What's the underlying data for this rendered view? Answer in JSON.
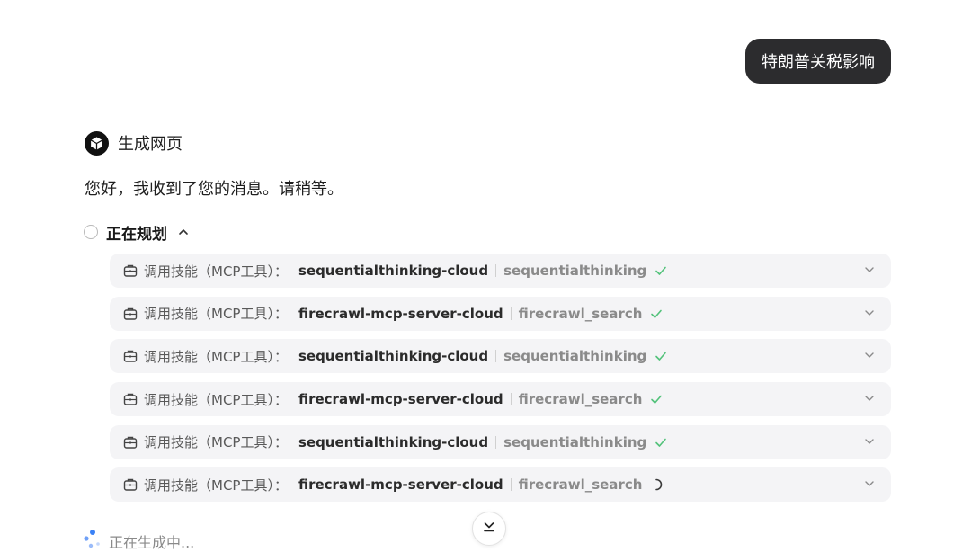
{
  "user_message": "特朗普关税影响",
  "agent": {
    "name": "生成网页",
    "greeting": "您好，我收到了您的消息。请稍等。"
  },
  "planning": {
    "title": "正在规划"
  },
  "tool_prefix": "调用技能（MCP工具）：",
  "tool_calls": [
    {
      "server": "sequentialthinking-cloud",
      "tool": "sequentialthinking",
      "status": "done"
    },
    {
      "server": "firecrawl-mcp-server-cloud",
      "tool": "firecrawl_search",
      "status": "done"
    },
    {
      "server": "sequentialthinking-cloud",
      "tool": "sequentialthinking",
      "status": "done"
    },
    {
      "server": "firecrawl-mcp-server-cloud",
      "tool": "firecrawl_search",
      "status": "done"
    },
    {
      "server": "sequentialthinking-cloud",
      "tool": "sequentialthinking",
      "status": "done"
    },
    {
      "server": "firecrawl-mcp-server-cloud",
      "tool": "firecrawl_search",
      "status": "loading"
    }
  ],
  "status_text": "正在生成中...",
  "icons": {
    "avatar": "cube-icon",
    "tool": "toolbox-icon",
    "done": "check-icon",
    "loading": "spinner-icon",
    "expand": "chevron-down-icon",
    "collapse": "chevron-up-icon",
    "scroll": "scroll-to-bottom-icon"
  },
  "colors": {
    "bubble_bg": "#2c2c2e",
    "row_bg": "#f4f4f6",
    "check": "#52c27a",
    "loader_blue": "#3b82f6"
  }
}
